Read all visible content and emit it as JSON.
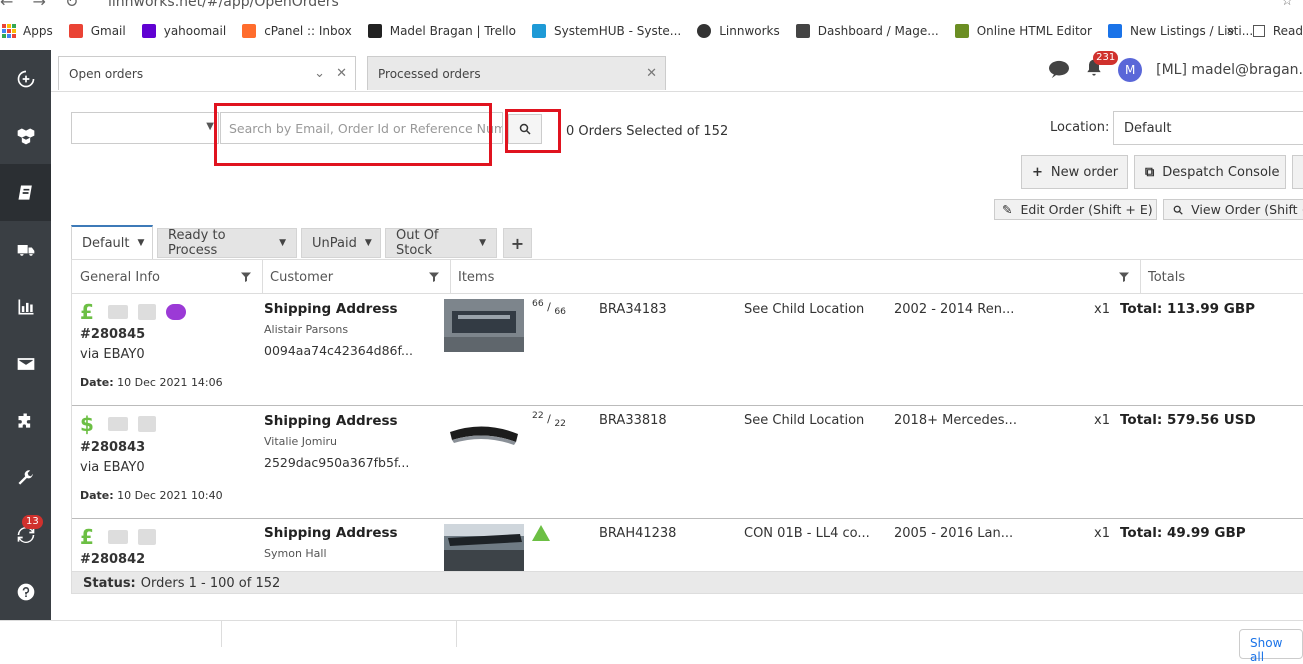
{
  "browser": {
    "url": "linnworks.net/#/app/OpenOrders",
    "bookmarks": [
      {
        "label": "Apps",
        "color": "#4285f4"
      },
      {
        "label": "Gmail",
        "color": "#ea4335"
      },
      {
        "label": "yahoomail",
        "color": "#6001d2"
      },
      {
        "label": "cPanel :: Inbox",
        "color": "#ff6c2c"
      },
      {
        "label": "Madel Bragan | Trello",
        "color": "#222222"
      },
      {
        "label": "SystemHUB - Syste...",
        "color": "#1e9ad6"
      },
      {
        "label": "Linnworks",
        "color": "#333333"
      },
      {
        "label": "Dashboard / Mage...",
        "color": "#444444"
      },
      {
        "label": "Online HTML Editor",
        "color": "#6b8e23"
      },
      {
        "label": "New Listings / Listi...",
        "color": "#1a73e8"
      }
    ],
    "more": "»",
    "reading_list": "Read"
  },
  "sidebar": {
    "badge_count": "13"
  },
  "tabs": {
    "open": "Open orders",
    "processed": "Processed orders"
  },
  "header": {
    "notif_count": "231",
    "avatar_letter": "M",
    "user": "[ML] madel@bragan."
  },
  "search": {
    "placeholder": "Search by Email, Order Id or Reference Numl",
    "orders_selected": "0 Orders Selected of 152"
  },
  "location": {
    "label": "Location:",
    "value": "Default"
  },
  "buttons": {
    "new_order": "New order",
    "despatch": "Despatch Console",
    "edit_order": "Edit Order (Shift + E)",
    "view_order": "View Order (Shift +"
  },
  "filters": [
    "Default",
    "Ready to Process",
    "UnPaid",
    "Out Of Stock"
  ],
  "columns": {
    "general": "General Info",
    "customer": "Customer",
    "items": "Items",
    "totals": "Totals"
  },
  "orders": [
    {
      "currency": "£",
      "number": "#280845",
      "via": "via EBAY0",
      "date_label": "Date:",
      "date": "10 Dec 2021 14:06",
      "ship_title": "Shipping Address",
      "name": "Alistair Parsons",
      "customer_id": "0094aa74c42364d86f...",
      "qty_a": "66",
      "qty_b": "66",
      "sku": "BRA34183",
      "location": "See Child Location",
      "title": "2002 - 2014 Ren...",
      "x": "x1",
      "total": "Total: 113.99 GBP"
    },
    {
      "currency": "$",
      "number": "#280843",
      "via": "via EBAY0",
      "date_label": "Date:",
      "date": "10 Dec 2021 10:40",
      "ship_title": "Shipping Address",
      "name": "Vitalie Jomiru",
      "customer_id": "2529dac950a367fb5f...",
      "qty_a": "22",
      "qty_b": "22",
      "sku": "BRA33818",
      "location": "See Child Location",
      "title": "2018+ Mercedes...",
      "x": "x1",
      "total": "Total: 579.56 USD"
    },
    {
      "currency": "£",
      "number": "#280842",
      "ship_title": "Shipping Address",
      "name": "Symon Hall",
      "sku": "BRAH41238",
      "location": "CON 01B - LL4 co...",
      "title": "2005 - 2016 Lan...",
      "x": "x1",
      "total": "Total: 49.99 GBP"
    }
  ],
  "status": {
    "label": "Status:",
    "text": "Orders 1 - 100 of 152"
  },
  "bottom": {
    "show_all": "Show all"
  }
}
